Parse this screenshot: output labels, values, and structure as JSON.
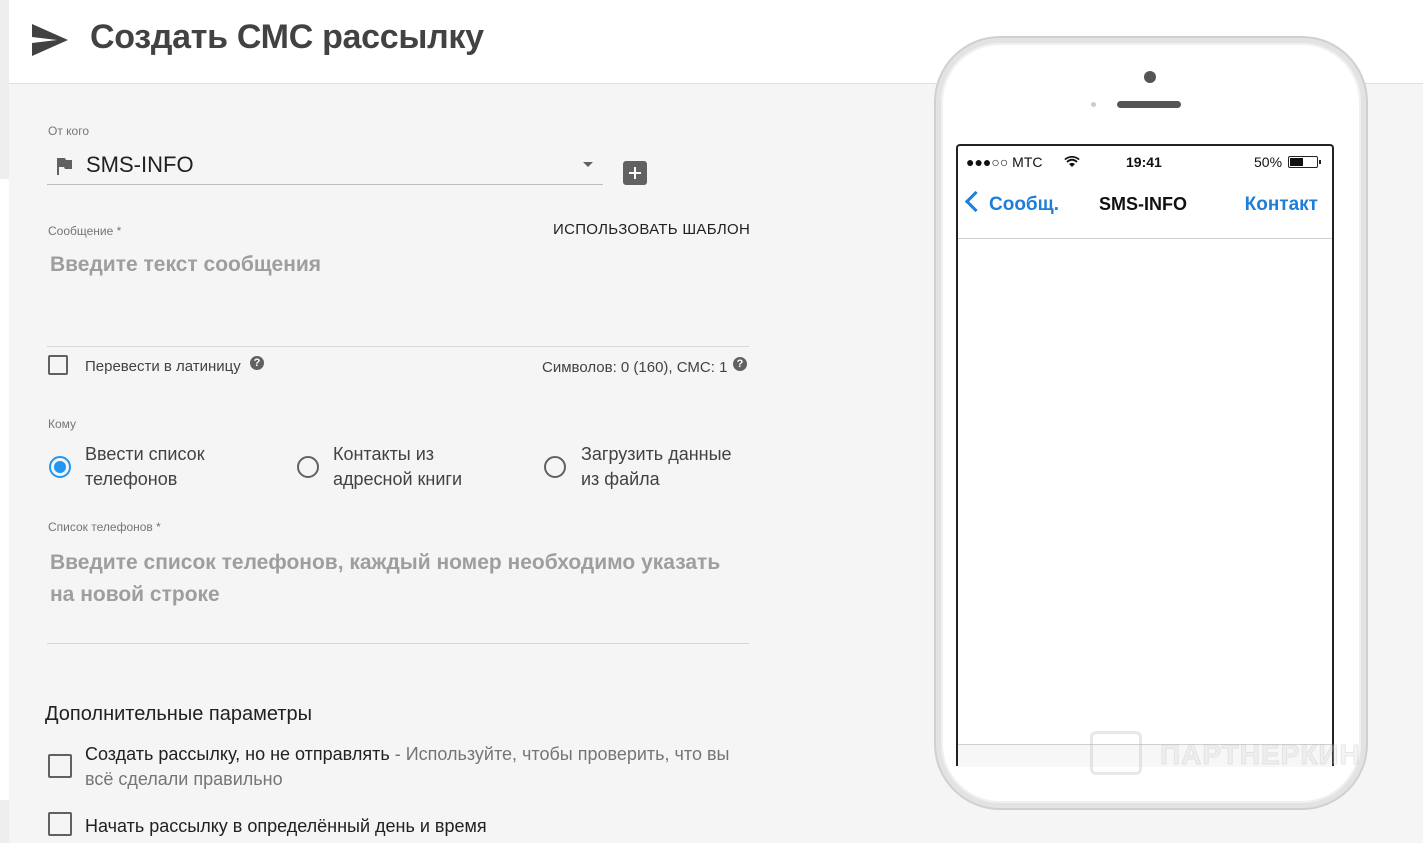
{
  "header": {
    "title": "Создать СМС рассылку",
    "icon": "send-icon"
  },
  "from": {
    "label": "От кого",
    "value": "SMS-INFO",
    "icon": "flag-icon",
    "add_icon": "add-box-icon"
  },
  "message": {
    "label": "Сообщение *",
    "use_template": "ИСПОЛЬЗОВАТЬ ШАБЛОН",
    "placeholder": "Введите текст сообщения",
    "transliterate_label": "Перевести в латиницу",
    "counter": "Символов: 0 (160), СМС: 1"
  },
  "recipients": {
    "label": "Кому",
    "options": [
      {
        "label": "Ввести список телефонов",
        "selected": true
      },
      {
        "label": "Контакты из адресной книги",
        "selected": false
      },
      {
        "label": "Загрузить данные из файла",
        "selected": false
      }
    ],
    "phones_label": "Список телефонов *",
    "phones_placeholder": "Введите список телефонов, каждый номер необходимо указать на новой строке"
  },
  "extra": {
    "title": "Дополнительные параметры",
    "options": [
      {
        "label": "Создать рассылку, но не отправлять",
        "hint": " - Используйте, чтобы проверить, что вы всё сделали правильно",
        "checked": false
      },
      {
        "label": "Начать рассылку в определённый день и время",
        "checked": false
      }
    ]
  },
  "preview": {
    "carrier": "●●●○○ МТС",
    "time": "19:41",
    "battery": "50%",
    "battery_level": 0.5,
    "back": "Сообщ.",
    "title": "SMS-INFO",
    "contact": "Контакт"
  },
  "watermark": {
    "text": "ПАРТНЕРКИН"
  },
  "colors": {
    "accent": "#2196f3",
    "ios_blue": "#1e7ed8",
    "background": "#f5f5f5"
  }
}
